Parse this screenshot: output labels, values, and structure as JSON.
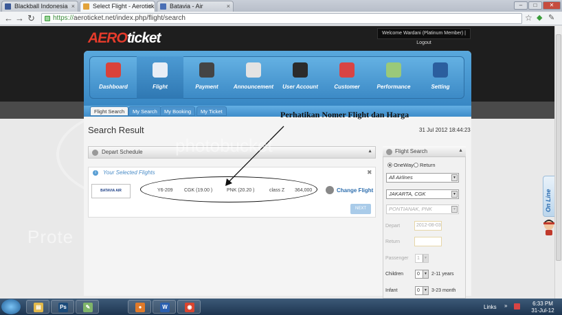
{
  "browser": {
    "tabs": [
      {
        "label": "Blackball Indonesia",
        "icon": "facebook-icon",
        "color": "#3b5998"
      },
      {
        "label": "Select Flight - Aeroticket",
        "icon": "plane-icon",
        "color": "#e2a33a"
      },
      {
        "label": "Batavia - Air",
        "icon": "airline-icon",
        "color": "#4a6fb5"
      }
    ],
    "url_scheme": "https://",
    "url_rest": "aeroticket.net/index.php/flight/search",
    "window_buttons": [
      "–",
      "□",
      "✕"
    ]
  },
  "header": {
    "logo_aero": "AERO",
    "logo_ticket": "ticket",
    "welcome": "Welcome Wardani (Platinum Member) | Logout"
  },
  "menu": [
    {
      "label": "Dashboard",
      "icon": "house-icon",
      "color": "#d9423a"
    },
    {
      "label": "Flight",
      "icon": "airplane-icon",
      "color": "#e8eef6"
    },
    {
      "label": "Payment",
      "icon": "safe-box-icon",
      "color": "#444444"
    },
    {
      "label": "Announcement",
      "icon": "megaphone-icon",
      "color": "#e3e3e3"
    },
    {
      "label": "User Account",
      "icon": "user-icon",
      "color": "#2b2b2b"
    },
    {
      "label": "Customer",
      "icon": "clipboard-icon",
      "color": "#d94444"
    },
    {
      "label": "Performance",
      "icon": "gauge-icon",
      "color": "#9ac97a"
    },
    {
      "label": "Setting",
      "icon": "gear-icon",
      "color": "#2b5e9e"
    }
  ],
  "subtabs": [
    "Flight Search",
    "My Search",
    "My Booking",
    "My Ticket"
  ],
  "search_result": {
    "title": "Search Result",
    "datetime": "31 Jul 2012 18:44:23",
    "depart_panel": "Depart Schedule",
    "selected_title": "Your Selected Flights",
    "close": "✖",
    "airline_logo": "BATAVIA AIR",
    "flight": {
      "code": "Y6-209",
      "from": "CGK (19.00 )",
      "to": "PNK (20.20 )",
      "class": "class Z",
      "price": "364,000"
    },
    "change_flight": "Change Flight",
    "next_button": "NEXT"
  },
  "annotation": "Perhatikan Nomer Flight dan Harga",
  "flight_search": {
    "title": "Flight Search",
    "oneway": "OneWay",
    "return": "Return",
    "airlines": "All Airlines",
    "origin": "JAKARTA, CGK",
    "destination": "PONTIANAK, PNK",
    "depart_label": "Depart",
    "depart_value": "2012-08-03",
    "return_label": "Return",
    "passenger_label": "Passenger",
    "passenger_value": "1",
    "children_label": "Children",
    "children_value": "0",
    "children_hint": "2-11 years",
    "infant_label": "Infant",
    "infant_value": "0",
    "infant_hint": "3-23 month"
  },
  "online_chat": "On Line",
  "watermark": {
    "brand": "photobucket",
    "protect": "Prote"
  },
  "taskbar": {
    "apps": [
      {
        "name": "explorer-icon",
        "glyph": "▤",
        "color": "#e1b84a"
      },
      {
        "name": "photoshop-icon",
        "glyph": "Ps",
        "color": "#1b4b7a"
      },
      {
        "name": "notepad-icon",
        "glyph": "✎",
        "color": "#7fb46a"
      },
      {
        "name": "firefox-icon",
        "glyph": "●",
        "color": "#e07a2a"
      },
      {
        "name": "word-icon",
        "glyph": "W",
        "color": "#2a5fb0"
      },
      {
        "name": "chrome-icon",
        "glyph": "◉",
        "color": "#d9452f"
      }
    ],
    "links": "Links",
    "time": "6:33 PM",
    "date": "31-Jul-12"
  }
}
